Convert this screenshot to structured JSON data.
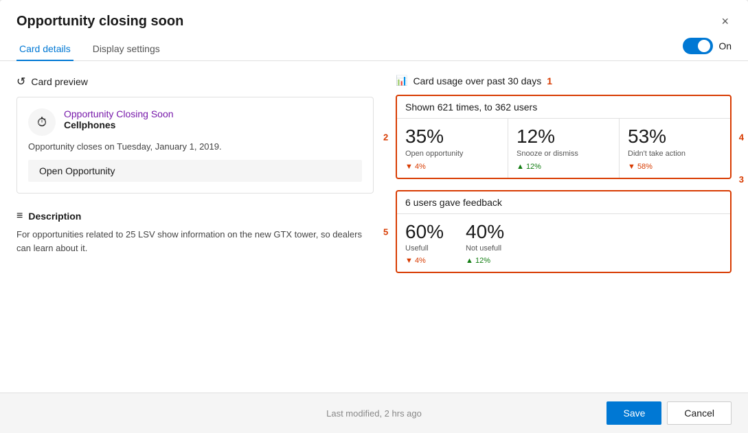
{
  "dialog": {
    "title": "Opportunity closing soon",
    "close_icon": "×"
  },
  "tabs": {
    "card_details_label": "Card details",
    "display_settings_label": "Display settings",
    "active": "card_details"
  },
  "toggle": {
    "label": "On",
    "on": true
  },
  "card_preview": {
    "section_label": "Card preview",
    "icon": "⏱",
    "title": "Opportunity Closing Soon",
    "subtitle": "Cellphones",
    "body": "Opportunity closes on Tuesday, January 1, 2019.",
    "action_label": "Open Opportunity"
  },
  "description": {
    "section_label": "Description",
    "text": "For opportunities related to 25 LSV show information on the new GTX tower, so dealers can learn about it."
  },
  "card_usage": {
    "section_label": "Card usage over past 30 days",
    "num_label": "1",
    "shown_text": "Shown 621 times, to 362 users",
    "stats": [
      {
        "pct": "35%",
        "desc": "Open opportunity",
        "trend": "▼ 4%",
        "trend_dir": "down",
        "num_label": "2"
      },
      {
        "pct": "12%",
        "desc": "Snooze or dismiss",
        "trend": "▲ 12%",
        "trend_dir": "up"
      },
      {
        "pct": "53%",
        "desc": "Didn't take action",
        "trend": "▼ 58%",
        "trend_dir": "down",
        "num_label": "4"
      }
    ],
    "num_label_3": "3",
    "feedback": {
      "header": "6 users gave feedback",
      "num_label": "5",
      "cells": [
        {
          "pct": "60%",
          "desc": "Usefull",
          "trend": "▼ 4%",
          "trend_dir": "down"
        },
        {
          "pct": "40%",
          "desc": "Not usefull",
          "trend": "▲ 12%",
          "trend_dir": "up"
        }
      ]
    }
  },
  "footer": {
    "modified_text": "Last modified, 2 hrs ago",
    "save_label": "Save",
    "cancel_label": "Cancel"
  }
}
